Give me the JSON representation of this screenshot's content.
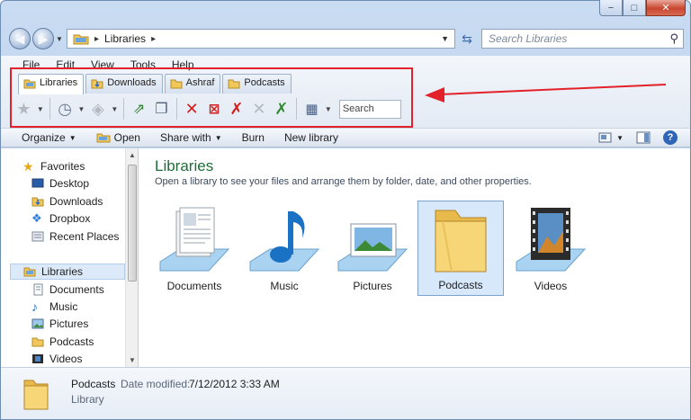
{
  "window": {
    "caption_buttons": [
      "−",
      "□",
      "✕"
    ]
  },
  "address_bar": {
    "breadcrumb": "Libraries",
    "search_placeholder": "Search Libraries"
  },
  "menu": [
    "File",
    "Edit",
    "View",
    "Tools",
    "Help"
  ],
  "tabs": [
    {
      "label": "Libraries",
      "active": true
    },
    {
      "label": "Downloads",
      "active": false
    },
    {
      "label": "Ashraf",
      "active": false
    },
    {
      "label": "Podcasts",
      "active": false
    }
  ],
  "toolbar": {
    "search_placeholder": "Search"
  },
  "command_bar": {
    "organize": "Organize",
    "open": "Open",
    "share_with": "Share with",
    "burn": "Burn",
    "new_library": "New library"
  },
  "nav_pane": {
    "favorites_header": "Favorites",
    "favorites": [
      "Desktop",
      "Downloads",
      "Dropbox",
      "Recent Places"
    ],
    "libraries_header": "Libraries",
    "libraries": [
      "Documents",
      "Music",
      "Pictures",
      "Podcasts",
      "Videos"
    ]
  },
  "content": {
    "title": "Libraries",
    "subtitle": "Open a library to see your files and arrange them by folder, date, and other properties.",
    "items": [
      {
        "label": "Documents",
        "icon": "documents-library-icon",
        "selected": false
      },
      {
        "label": "Music",
        "icon": "music-library-icon",
        "selected": false
      },
      {
        "label": "Pictures",
        "icon": "pictures-library-icon",
        "selected": false
      },
      {
        "label": "Podcasts",
        "icon": "podcasts-library-icon",
        "selected": true
      },
      {
        "label": "Videos",
        "icon": "videos-library-icon",
        "selected": false
      }
    ]
  },
  "details": {
    "name": "Podcasts",
    "modified_label": "Date modified:",
    "modified_value": "7/12/2012 3:33 AM",
    "type": "Library"
  },
  "colors": {
    "title_green": "#1f6d39",
    "highlight_red": "#e3212a",
    "selection_blue": "#d7e8fb"
  }
}
